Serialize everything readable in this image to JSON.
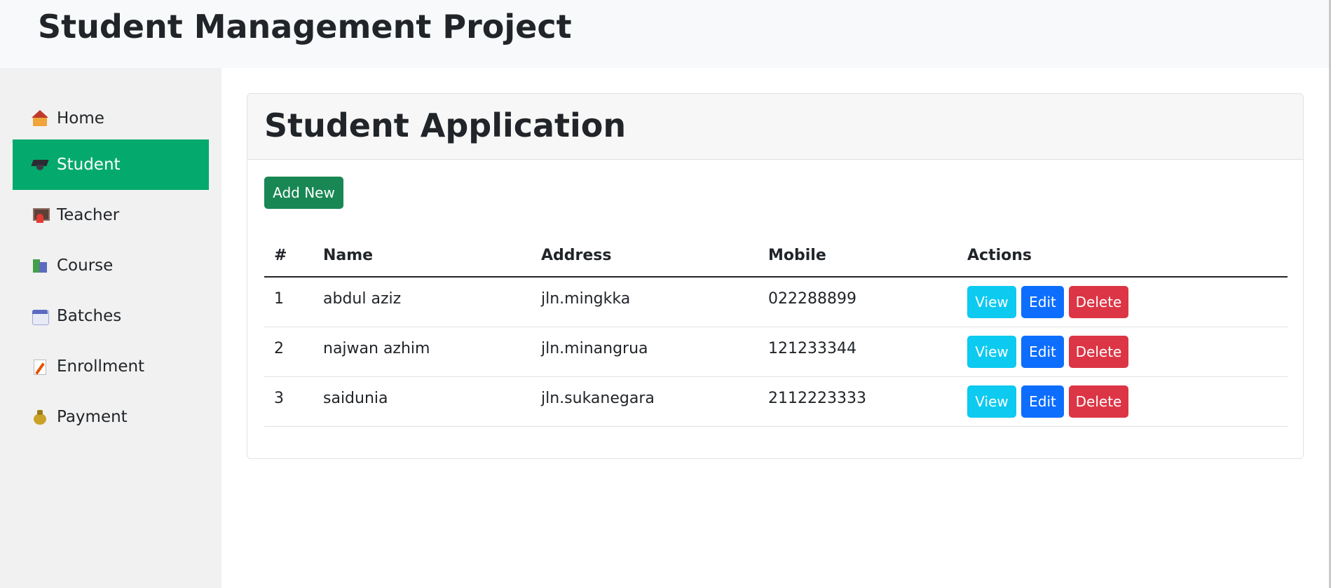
{
  "app": {
    "title": "Student Management Project"
  },
  "sidebar": {
    "items": [
      {
        "label": "Home",
        "icon": "house-icon",
        "active": false
      },
      {
        "label": "Student",
        "icon": "graduation-cap-icon",
        "active": true
      },
      {
        "label": "Teacher",
        "icon": "teacher-icon",
        "active": false
      },
      {
        "label": "Course",
        "icon": "books-icon",
        "active": false
      },
      {
        "label": "Batches",
        "icon": "calendar-icon",
        "active": false
      },
      {
        "label": "Enrollment",
        "icon": "memo-icon",
        "active": false
      },
      {
        "label": "Payment",
        "icon": "money-bag-icon",
        "active": false
      }
    ],
    "active_color": "#04aa6d"
  },
  "main": {
    "card_title": "Student Application",
    "add_button": "Add New",
    "table": {
      "headers": [
        "#",
        "Name",
        "Address",
        "Mobile",
        "Actions"
      ],
      "rows": [
        {
          "id": "1",
          "name": "abdul aziz",
          "address": "jln.mingkka",
          "mobile": "022288899"
        },
        {
          "id": "2",
          "name": "najwan azhim",
          "address": "jln.minangrua",
          "mobile": "121233344"
        },
        {
          "id": "3",
          "name": "saidunia",
          "address": "jln.sukanegara",
          "mobile": "2112223333"
        }
      ],
      "actions": {
        "view": "View",
        "edit": "Edit",
        "delete": "Delete"
      }
    }
  },
  "colors": {
    "add": "#198754",
    "view": "#0dcaf0",
    "edit": "#0d6efd",
    "delete": "#dc3545"
  }
}
